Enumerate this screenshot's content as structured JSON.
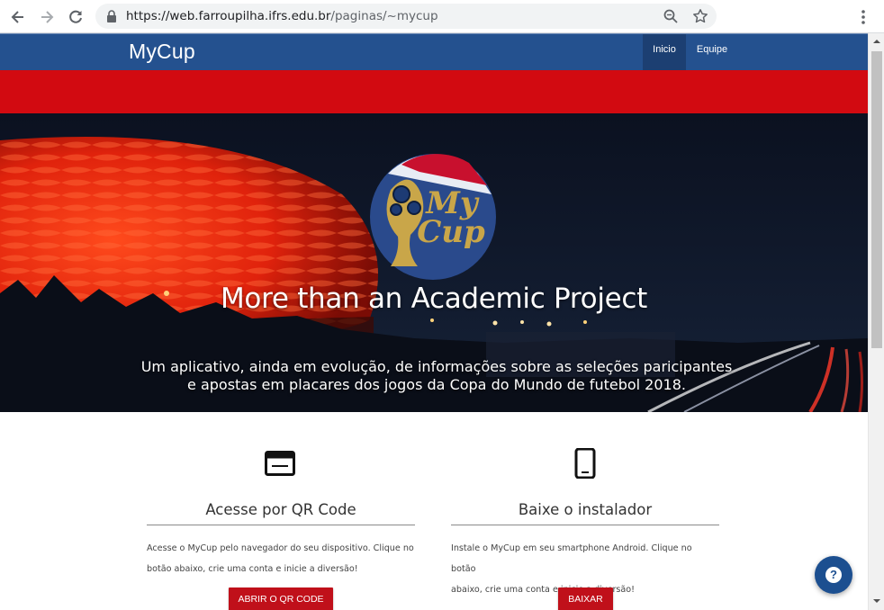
{
  "browser": {
    "url_host": "https://web.farroupilha.ifrs.edu.br",
    "url_path": "/paginas/~mycup",
    "icons": [
      "back-arrow-icon",
      "forward-arrow-icon",
      "reload-icon",
      "lock-icon",
      "zoom-icon",
      "star-icon",
      "menu-dots-icon"
    ]
  },
  "site": {
    "brand": "MyCup",
    "nav": [
      {
        "label": "Inicio",
        "active": true
      },
      {
        "label": "Equipe",
        "active": false
      }
    ],
    "colors": {
      "navbar": "#24518f",
      "red_band": "#d20a11",
      "button": "#c0101a"
    }
  },
  "hero": {
    "logo_text_line1": "My",
    "logo_text_line2": "Cup",
    "title": "More than an Academic Project",
    "subtitle_line1": "Um aplicativo, ainda em evolução, de informações sobre as seleções paricipantes",
    "subtitle_line2": "e apostas em placares dos jogos da Copa do Mundo de futebol 2018."
  },
  "features": [
    {
      "icon": "browser-window-icon",
      "title": "Acesse por QR Code",
      "text_line1": "Acesse o MyCup pelo navegador do seu dispositivo. Clique no",
      "text_line2": "botão abaixo, crie uma conta e inicie a diversão!",
      "button": "ABRIR O QR CODE"
    },
    {
      "icon": "smartphone-icon",
      "title": "Baixe o instalador",
      "text_line1": "Instale o MyCup em seu smartphone Android. Clique no botão",
      "text_line2": "abaixo, crie uma conta e inicie a diversão!",
      "button": "BAIXAR"
    }
  ],
  "help_button": "?"
}
